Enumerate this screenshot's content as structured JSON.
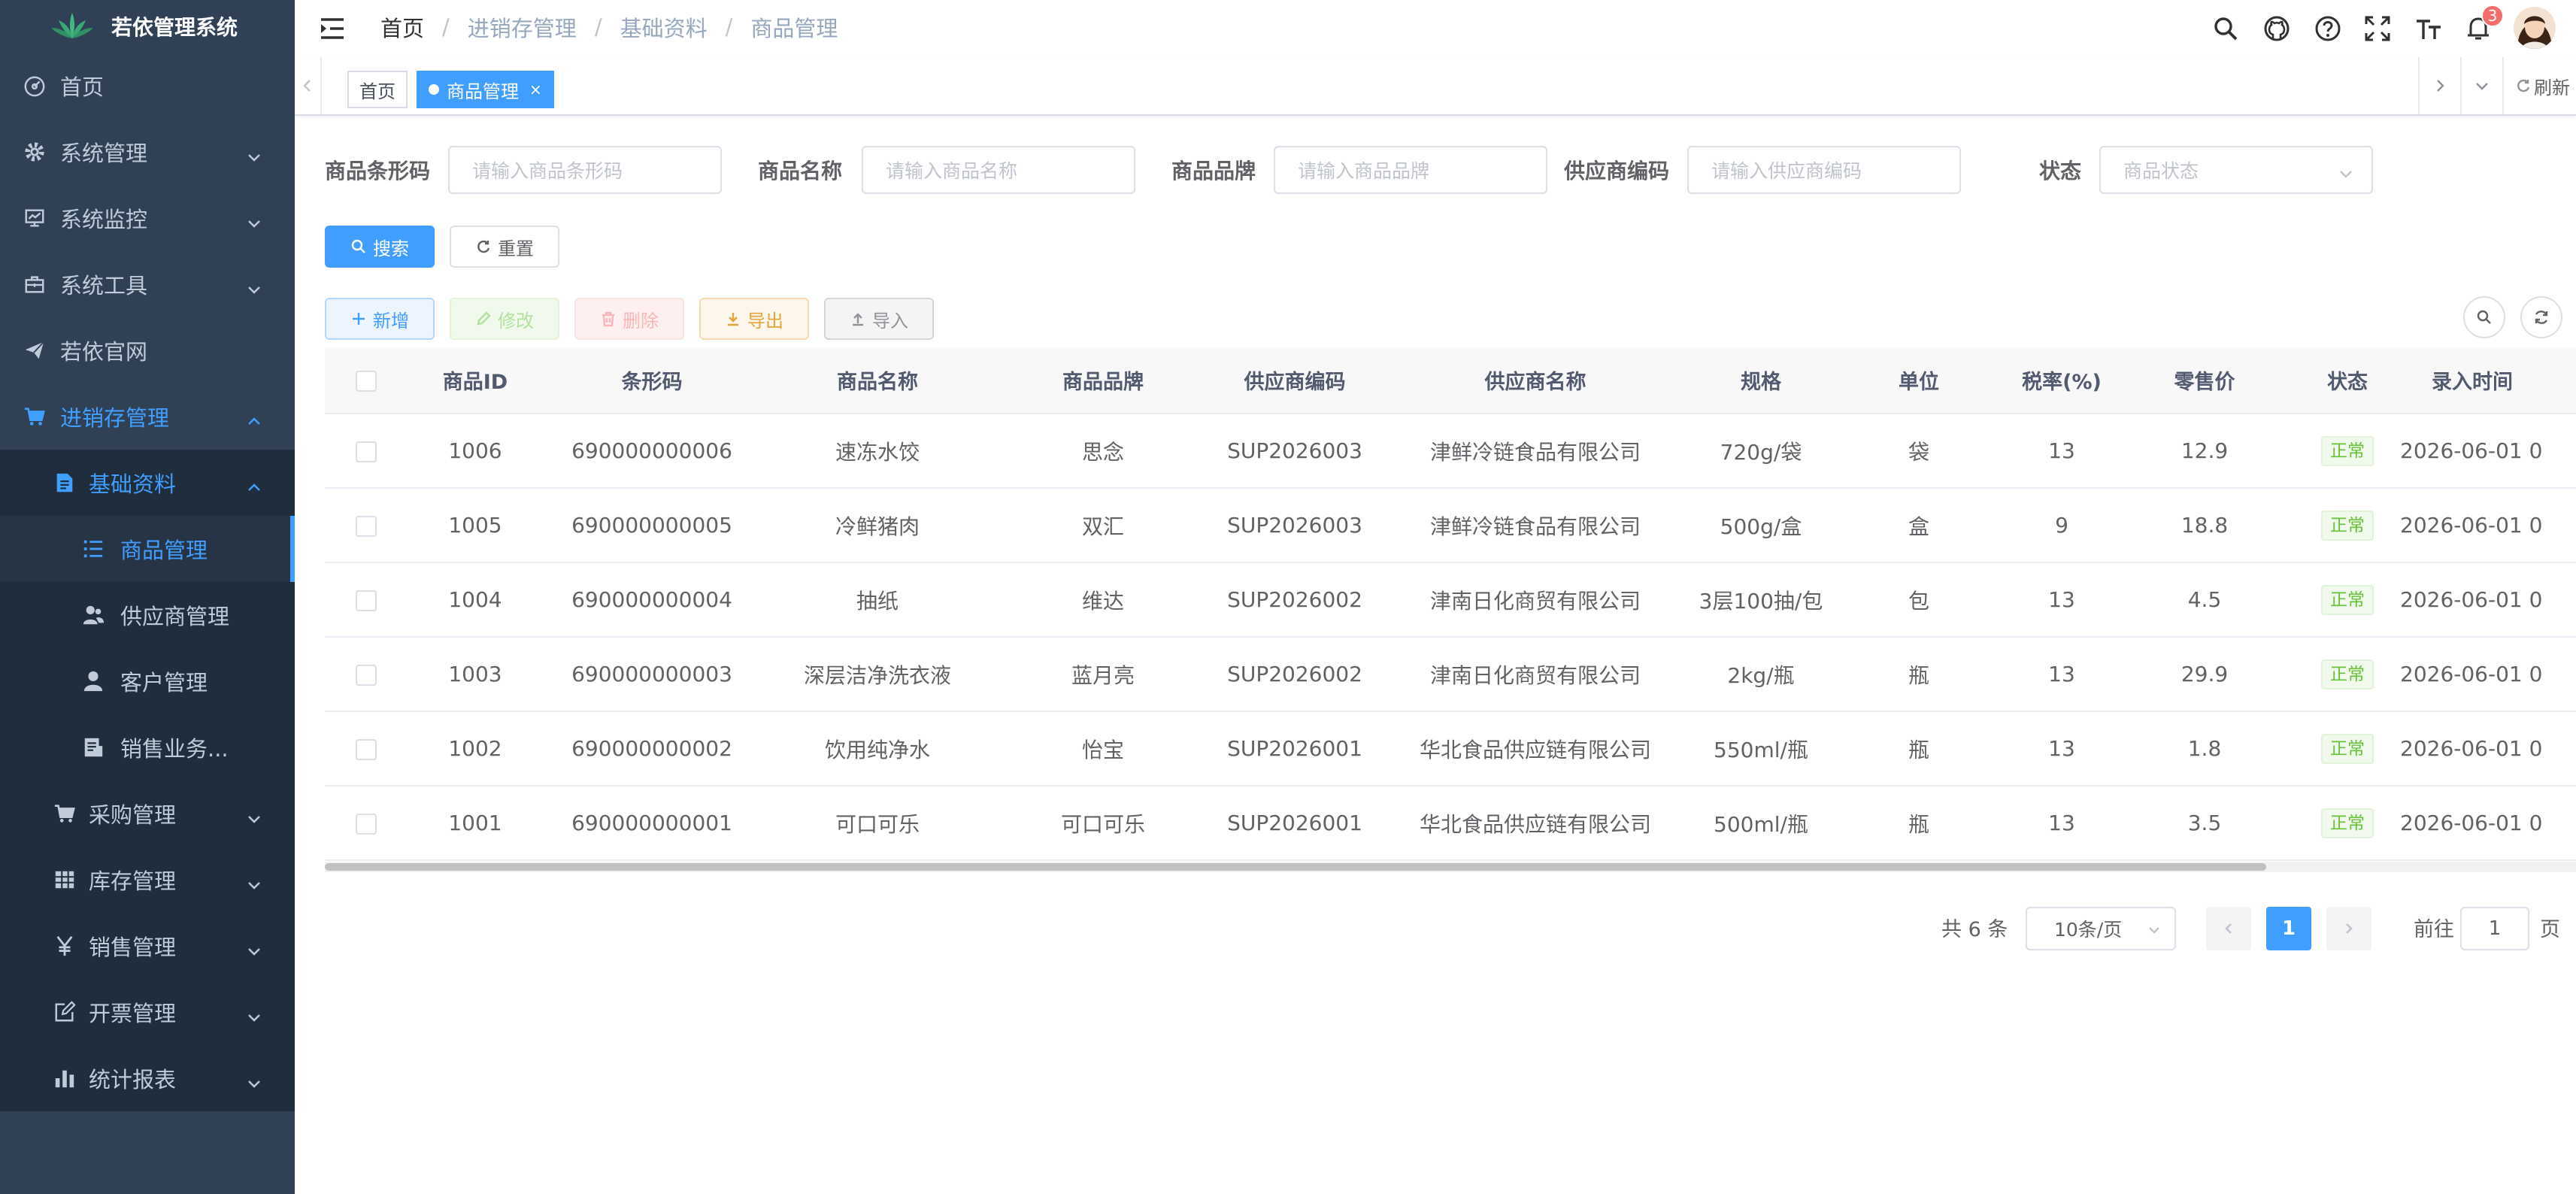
{
  "app": {
    "title": "若依管理系统"
  },
  "sidebar": {
    "items": [
      {
        "label": "首页",
        "icon": "dashboard-icon"
      },
      {
        "label": "系统管理",
        "icon": "gear-icon"
      },
      {
        "label": "系统监控",
        "icon": "monitor-icon"
      },
      {
        "label": "系统工具",
        "icon": "toolbox-icon"
      },
      {
        "label": "若依官网",
        "icon": "send-icon"
      },
      {
        "label": "进销存管理",
        "icon": "cart-icon"
      },
      {
        "label": "基础资料",
        "icon": "document-icon"
      },
      {
        "label": "商品管理",
        "icon": "list-icon"
      },
      {
        "label": "供应商管理",
        "icon": "peoples-icon"
      },
      {
        "label": "客户管理",
        "icon": "user-icon"
      },
      {
        "label": "销售业务...",
        "icon": "form-icon"
      },
      {
        "label": "采购管理",
        "icon": "cart-icon"
      },
      {
        "label": "库存管理",
        "icon": "table-icon"
      },
      {
        "label": "销售管理",
        "icon": "yen-icon"
      },
      {
        "label": "开票管理",
        "icon": "edit-icon"
      },
      {
        "label": "统计报表",
        "icon": "chart-icon"
      }
    ]
  },
  "navbar": {
    "breadcrumb": [
      "首页",
      "进销存管理",
      "基础资料",
      "商品管理"
    ],
    "separator": "/",
    "notification_count": "3"
  },
  "tagsview": {
    "tags": [
      "首页",
      "商品管理"
    ],
    "close": "×",
    "refresh": "刷新"
  },
  "search": {
    "fields": [
      {
        "label": "商品条形码",
        "placeholder": "请输入商品条形码"
      },
      {
        "label": "商品名称",
        "placeholder": "请输入商品名称"
      },
      {
        "label": "商品品牌",
        "placeholder": "请输入商品品牌"
      },
      {
        "label": "供应商编码",
        "placeholder": "请输入供应商编码"
      },
      {
        "label": "状态",
        "placeholder": "商品状态"
      }
    ],
    "search_label": "搜索",
    "reset_label": "重置"
  },
  "toolbar": {
    "add": "新增",
    "edit": "修改",
    "delete": "删除",
    "export": "导出",
    "import": "导入"
  },
  "table": {
    "columns": [
      "商品ID",
      "条形码",
      "商品名称",
      "商品品牌",
      "供应商编码",
      "供应商名称",
      "规格",
      "单位",
      "税率(%)",
      "零售价",
      "状态",
      "录入时间"
    ],
    "rows": [
      [
        "1006",
        "690000000006",
        "速冻水饺",
        "思念",
        "SUP2026003",
        "津鲜冷链食品有限公司",
        "720g/袋",
        "袋",
        "13",
        "12.9",
        "正常",
        "2026-06-01 0"
      ],
      [
        "1005",
        "690000000005",
        "冷鲜猪肉",
        "双汇",
        "SUP2026003",
        "津鲜冷链食品有限公司",
        "500g/盒",
        "盒",
        "9",
        "18.8",
        "正常",
        "2026-06-01 0"
      ],
      [
        "1004",
        "690000000004",
        "抽纸",
        "维达",
        "SUP2026002",
        "津南日化商贸有限公司",
        "3层100抽/包",
        "包",
        "13",
        "4.5",
        "正常",
        "2026-06-01 0"
      ],
      [
        "1003",
        "690000000003",
        "深层洁净洗衣液",
        "蓝月亮",
        "SUP2026002",
        "津南日化商贸有限公司",
        "2kg/瓶",
        "瓶",
        "13",
        "29.9",
        "正常",
        "2026-06-01 0"
      ],
      [
        "1002",
        "690000000002",
        "饮用纯净水",
        "怡宝",
        "SUP2026001",
        "华北食品供应链有限公司",
        "550ml/瓶",
        "瓶",
        "13",
        "1.8",
        "正常",
        "2026-06-01 0"
      ],
      [
        "1001",
        "690000000001",
        "可口可乐",
        "可口可乐",
        "SUP2026001",
        "华北食品供应链有限公司",
        "500ml/瓶",
        "瓶",
        "13",
        "3.5",
        "正常",
        "2026-06-01 0"
      ]
    ]
  },
  "pagination": {
    "total": "共 6 条",
    "page_size": "10条/页",
    "current_page": "1",
    "goto_prefix": "前往",
    "goto_value": "1",
    "goto_suffix": "页"
  },
  "colors": {
    "sidebar_bg": "#304156",
    "accent": "#409eff",
    "success": "#67c23a"
  }
}
